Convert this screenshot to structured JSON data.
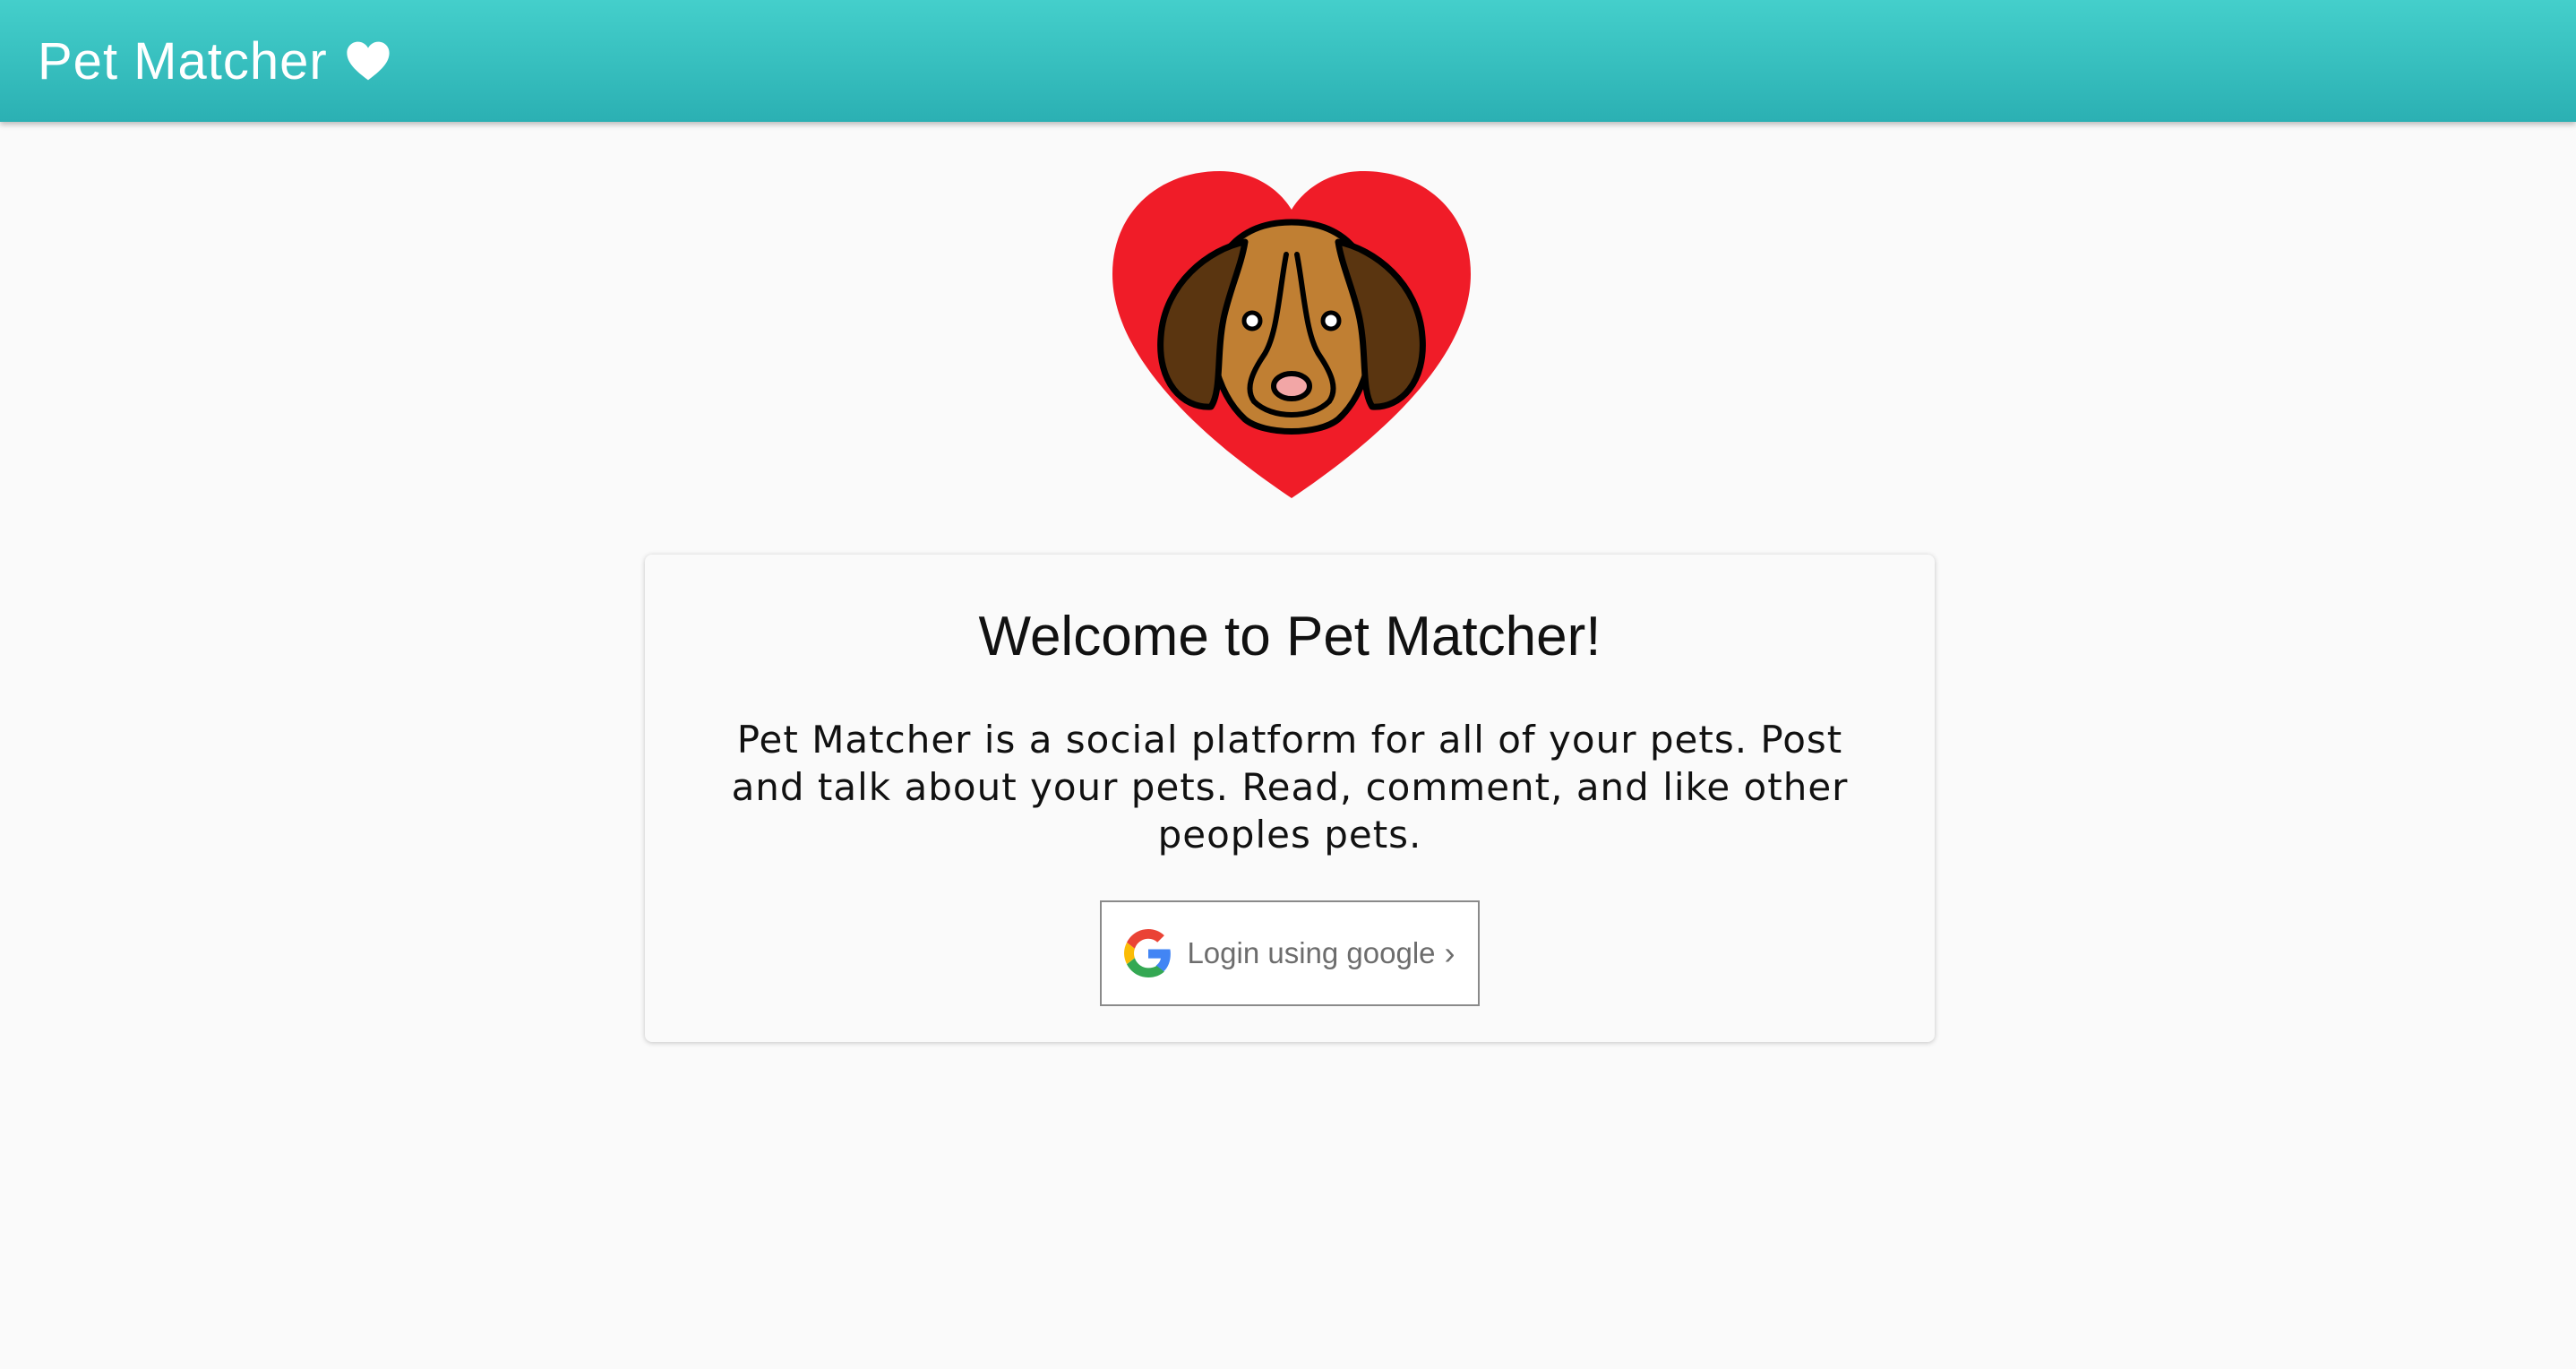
{
  "header": {
    "title": "Pet Matcher",
    "icon": "heart-icon"
  },
  "logo": {
    "icon": "dog-heart-logo",
    "colors": {
      "heart": "#f01c28",
      "dog": "#c07f33",
      "ears": "#5a3510"
    }
  },
  "card": {
    "title": "Welcome to Pet Matcher!",
    "body": "Pet Matcher is a social platform for all of your pets. Post and talk about your pets. Read, comment, and like other peoples pets.",
    "login_button": {
      "label": "Login using google",
      "chevron": "›",
      "icon": "google-icon"
    }
  },
  "colors": {
    "app_bar": "#3cc4c2",
    "background": "#fafafa"
  }
}
